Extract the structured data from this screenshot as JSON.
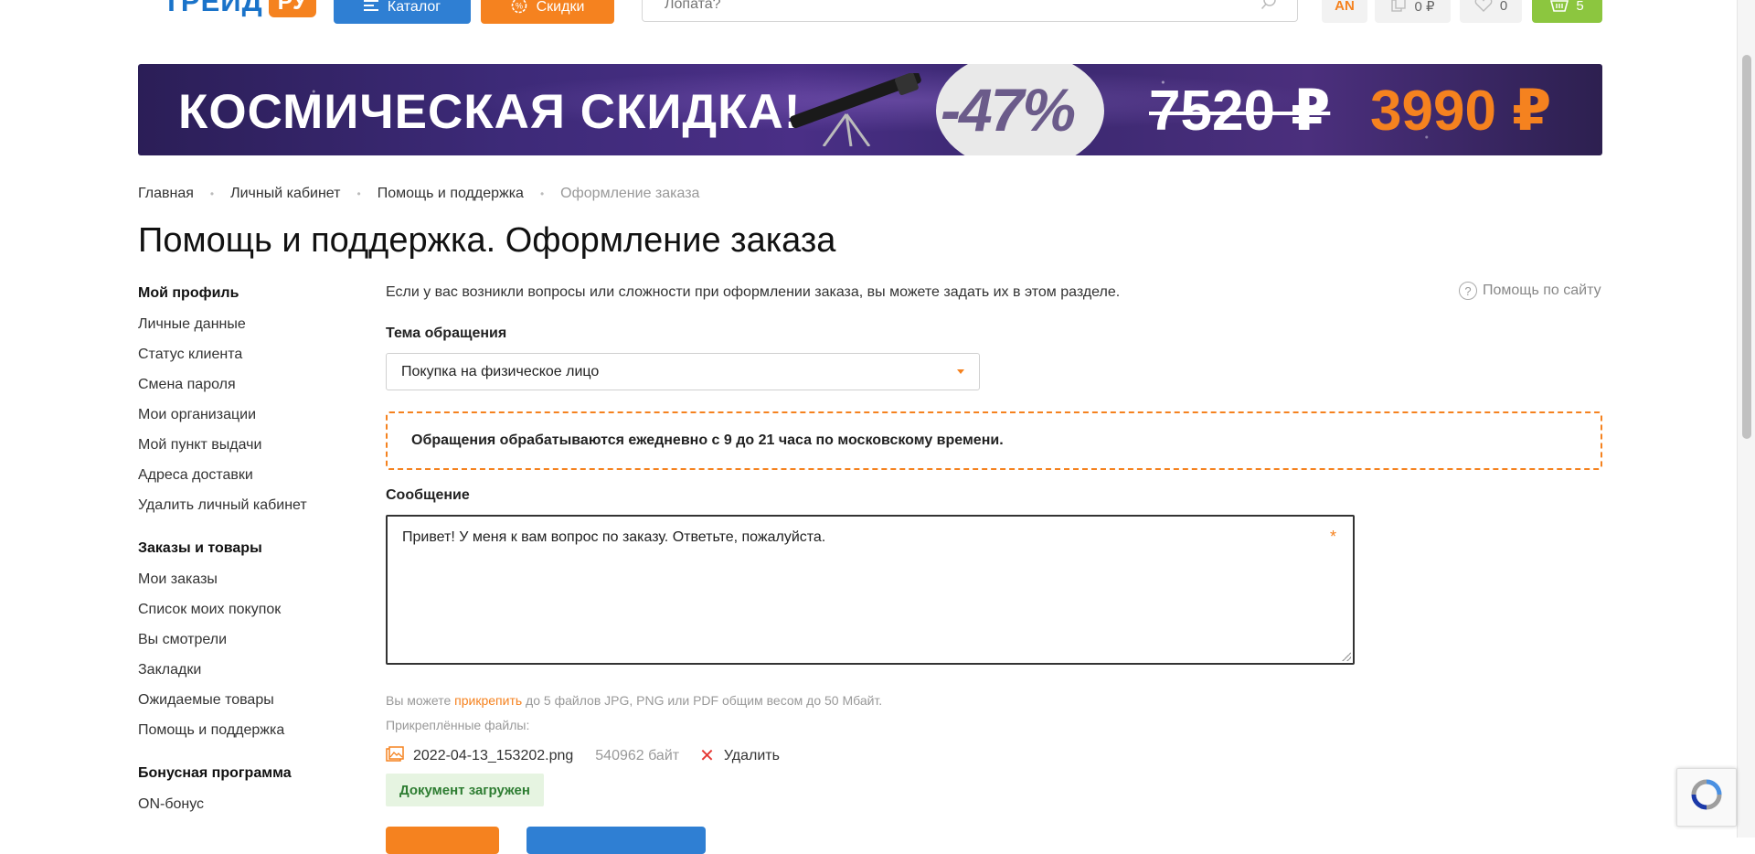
{
  "header": {
    "logo_text": "ТРЕЙД",
    "logo_suffix": "РУ",
    "catalog_label": "Каталог",
    "sale_label": "Скидки",
    "search_placeholder": "Лопата?",
    "user_initials": "AN",
    "compare_sum": "0 ₽",
    "favorites_count": "0",
    "cart_count": "5"
  },
  "banner": {
    "title": "КОСМИЧЕСКАЯ СКИДКА!",
    "discount": "-47%",
    "old_price": "7520 ₽",
    "new_price": "3990 ₽"
  },
  "breadcrumb": {
    "items": [
      "Главная",
      "Личный кабинет",
      "Помощь и поддержка"
    ],
    "current": "Оформление заказа"
  },
  "page_title": "Помощь и поддержка. Оформление заказа",
  "sidebar": {
    "groups": [
      {
        "title": "Мой профиль",
        "items": [
          "Личные данные",
          "Статус клиента",
          "Смена пароля",
          "Мои организации",
          "Мой пункт выдачи",
          "Адреса доставки",
          "Удалить личный кабинет"
        ]
      },
      {
        "title": "Заказы и товары",
        "items": [
          "Мои заказы",
          "Список моих покупок",
          "Вы смотрели",
          "Закладки",
          "Ожидаемые товары",
          "Помощь и поддержка"
        ]
      },
      {
        "title": "Бонусная программа",
        "items": [
          "ON-бонус"
        ]
      }
    ]
  },
  "main": {
    "intro": "Если у вас возникли вопросы или сложности при оформлении заказа, вы можете задать их в этом разделе.",
    "help_link": "Помощь по сайту",
    "topic_label": "Тема обращения",
    "topic_value": "Покупка на физическое лицо",
    "notice": "Обращения обрабатываются ежедневно с 9 до 21 часа по московскому времени.",
    "message_label": "Сообщение",
    "message_value": "Привет! У меня к вам вопрос по заказу. Ответьте, пожалуйста.",
    "required_mark": "*",
    "attach_hint_before": "Вы можете ",
    "attach_hint_link": "прикрепить",
    "attach_hint_after": " до 5 файлов JPG, PNG или PDF общим весом до 50 Мбайт.",
    "attached_label": "Прикреплённые файлы:",
    "file": {
      "name": "2022-04-13_153202.png",
      "size": "540962 байт",
      "delete_label": "Удалить"
    },
    "upload_status": "Документ загружен"
  },
  "colors": {
    "accent": "#f5821f",
    "primary": "#2f7fd3",
    "success_bg": "#e6f4e1",
    "success_text": "#2e7d32",
    "cart": "#8cc63f"
  }
}
